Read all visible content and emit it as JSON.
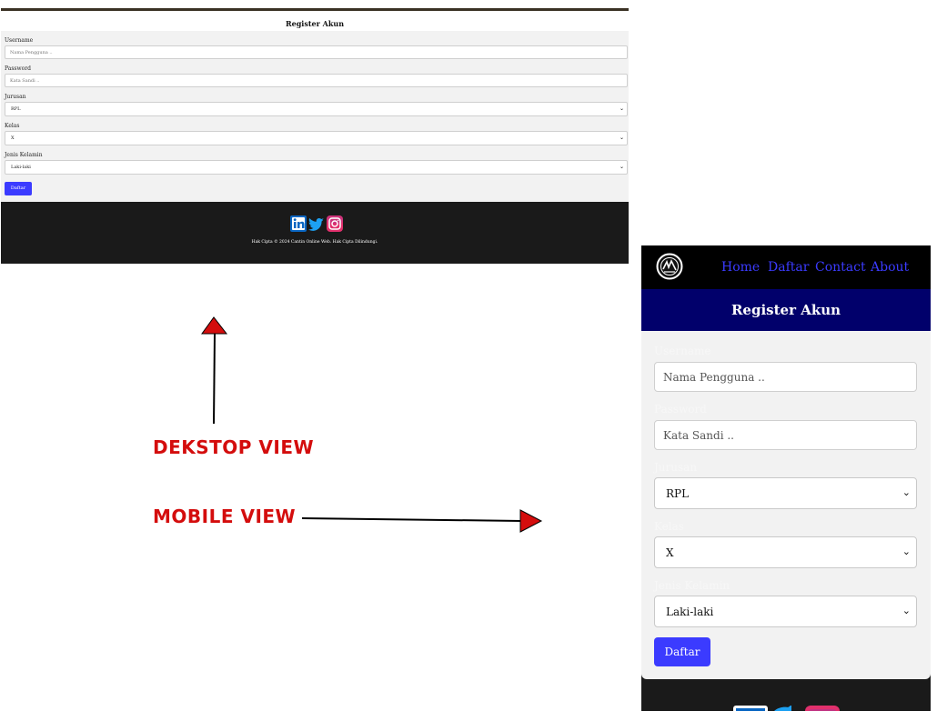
{
  "desktop": {
    "title": "Register Akun",
    "fields": {
      "username_label": "Username",
      "username_placeholder": "Nama Pengguna ..",
      "password_label": "Password",
      "password_placeholder": "Kata Sandi ..",
      "jurusan_label": "Jurusan",
      "jurusan_value": "RPL",
      "kelas_label": "Kelas",
      "kelas_value": "X",
      "gender_label": "Jenis Kelamin",
      "gender_value": "Laki-laki"
    },
    "submit_label": "Daftar",
    "footer_copyright": "Hak Cipta © 2024 Cantin Online Web. Hak Cipta Dilindungi."
  },
  "annotations": {
    "desktop_view": "DEKSTOP VIEW",
    "mobile_view": "MOBILE VIEW"
  },
  "mobile": {
    "nav": {
      "links": [
        "Home",
        "Daftar",
        "Contact",
        "About"
      ]
    },
    "title": "Register Akun",
    "fields": {
      "username_label": "Username",
      "username_placeholder": "Nama Pengguna ..",
      "password_label": "Password",
      "password_placeholder": "Kata Sandi ..",
      "jurusan_label": "Jurusan",
      "jurusan_value": "RPL",
      "kelas_label": "Kelas",
      "kelas_value": "X",
      "gender_label": "Jenis Kelamin",
      "gender_value": "Laki-laki"
    },
    "submit_label": "Daftar"
  },
  "icons": [
    "linkedin-icon",
    "twitter-icon",
    "instagram-icon",
    "logo-icon",
    "chevron-down-icon"
  ],
  "colors": {
    "accent": "#3b3bff",
    "header_blue": "#01006b",
    "footer": "#1a1a1a",
    "annotation": "#d40d0d"
  }
}
